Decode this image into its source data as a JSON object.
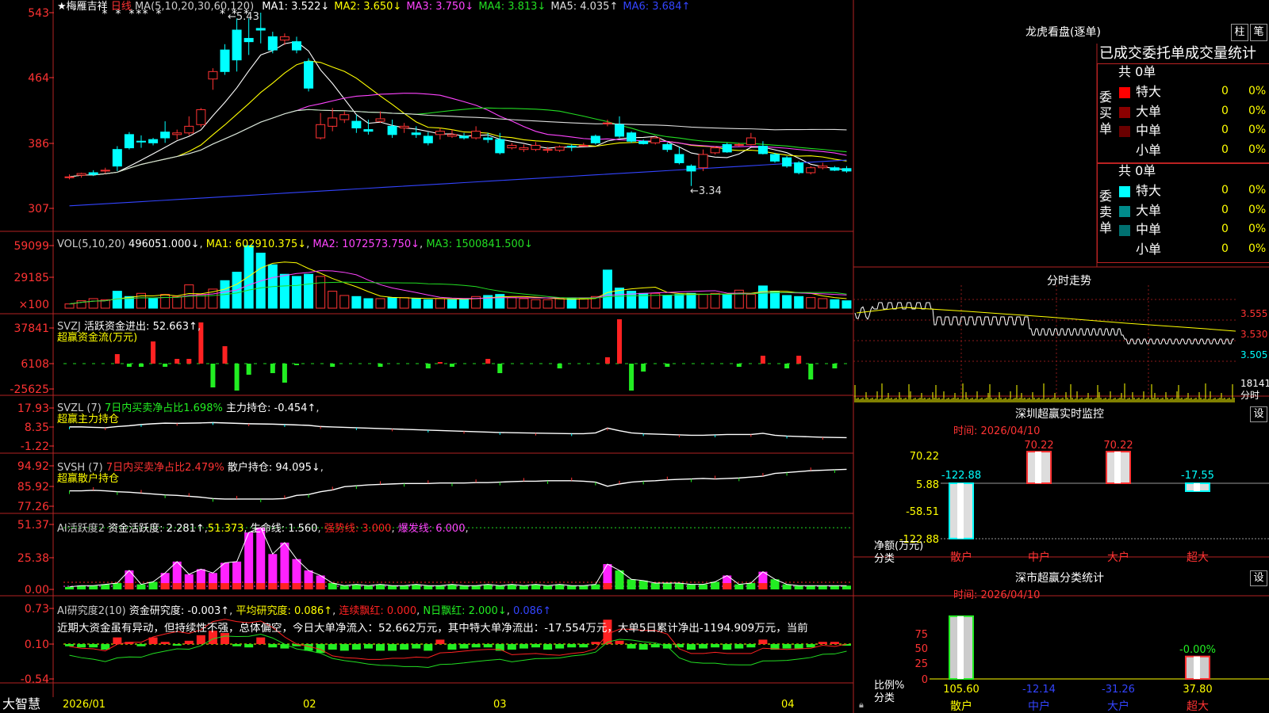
{
  "stock": {
    "name": "梅雁吉祥",
    "period": "日线",
    "ma_label": "MA(5,10,20,30,60,120)",
    "ma": [
      {
        "name": "MA1:",
        "value": "3.522↓",
        "color": "#ffffff"
      },
      {
        "name": "MA2:",
        "value": "3.650↓",
        "color": "#ffff00"
      },
      {
        "name": "MA3:",
        "value": "3.750↓",
        "color": "#ff44ff"
      },
      {
        "name": "MA4:",
        "value": "3.813↓",
        "color": "#22dd22"
      },
      {
        "name": "MA5:",
        "value": "4.035↑",
        "color": "#dddddd"
      },
      {
        "name": "MA6:",
        "value": "3.684↑",
        "color": "#3344ff"
      }
    ],
    "high_mark": "←5.43",
    "low_mark": "←3.34"
  },
  "axes": {
    "price": [
      "543",
      "464",
      "386",
      "307"
    ],
    "vol": [
      "59099",
      "29185",
      "×100"
    ],
    "svzj": [
      "37841",
      "6108",
      "-25625"
    ],
    "svzl": [
      "17.93",
      "8.35",
      "-1.22"
    ],
    "svsh": [
      "94.92",
      "85.92",
      "77.26"
    ],
    "ai2": [
      "51.37",
      "25.38",
      "0.00"
    ],
    "ai3": [
      "0.73",
      "0.10",
      "-0.54"
    ],
    "dates": [
      "2026/01",
      "02",
      "03",
      "04"
    ]
  },
  "panels": {
    "vol": {
      "label": "VOL(5,10,20)",
      "value": "496051.000↓",
      "ma1": "MA1: 602910.375↓",
      "ma2": "MA2: 1072573.750↓",
      "ma3": "MA3: 1500841.500↓"
    },
    "svzj": {
      "label": "SVZJ",
      "title": "活跃资金进出:",
      "value": "52.663↑",
      "comma": ",",
      "sub": "超赢资金流(万元)"
    },
    "svzl": {
      "label": "SVZL (7)",
      "title": "7日内买卖净占比1.698%",
      "extra": "主力持仓:",
      "value": "-0.454↑",
      "comma": ",",
      "sub": "超赢主力持仓"
    },
    "svsh": {
      "label": "SVSH (7)",
      "title": "7日内买卖净占比2.479%",
      "extra": "散户持仓:",
      "value": "94.095↓",
      "comma": ",",
      "sub": "超赢散户持仓"
    },
    "ai2": {
      "label": "AI活跃度2",
      "t1": "资金活跃度:",
      "v1": "2.281↑",
      "v2": "51.373",
      "t3": "生命线:",
      "v3": "1.560",
      "t4": "强势线:",
      "v4": "3.000",
      "t5": "爆发线:",
      "v5": "6.000"
    },
    "ai3": {
      "label": "AI研究度2(10)",
      "t1": "资金研究度:",
      "v1": "-0.003↑",
      "t2": "平均研究度:",
      "v2": "0.086↑",
      "t3": "连续飘红:",
      "v3": "0.000",
      "t4": "N日飘红:",
      "v4": "2.000↓",
      "v5": "0.086↑",
      "comment": "近期大资金虽有异动，但持续性不强，总体偏空，今日大单净流入：52.662万元，其中特大单净流出：-17.554万元，大单5日累计净出-1194.909万元，当前"
    }
  },
  "footer": {
    "logo": "大智慧"
  },
  "right": {
    "title": "龙虎看盘(逐单)",
    "btn1": "柱",
    "btn2": "笔",
    "header": "已成交委托单成交量统计",
    "buy": {
      "side": "委买单",
      "total": "共 0单",
      "rows": [
        {
          "label": "特大",
          "count": "0",
          "pct": "0%",
          "color": "#ff0000"
        },
        {
          "label": "大单",
          "count": "0",
          "pct": "0%",
          "color": "#8b0000"
        },
        {
          "label": "中单",
          "count": "0",
          "pct": "0%",
          "color": "#6a0000"
        },
        {
          "label": "小单",
          "count": "0",
          "pct": "0%",
          "color": ""
        }
      ]
    },
    "sell": {
      "side": "委卖单",
      "total": "共 0单",
      "rows": [
        {
          "label": "特大",
          "count": "0",
          "pct": "0%",
          "color": "#00ffff"
        },
        {
          "label": "大单",
          "count": "0",
          "pct": "0%",
          "color": "#008b8b"
        },
        {
          "label": "中单",
          "count": "0",
          "pct": "0%",
          "color": "#007070"
        },
        {
          "label": "小单",
          "count": "0",
          "pct": "0%",
          "color": ""
        }
      ]
    },
    "intraday": {
      "title": "分时走势",
      "p1": "3.555",
      "p2": "3.530",
      "p3": "3.505",
      "vol": "18141",
      "vlabel": "分时"
    },
    "monitor": {
      "title": "深圳超赢实时监控",
      "set": "设",
      "time": "时间: 2026/04/10",
      "yunit": "净额(万元)",
      "xunit": "分类"
    },
    "classify": {
      "title": "深市超赢分类统计",
      "set": "设",
      "time": "时间: 2026/04/10",
      "yunit": "比例%",
      "xunit": "分类"
    }
  },
  "chart_data": [
    {
      "type": "candlestick",
      "title": "梅雁吉祥 日线",
      "ylim": [
        3.07,
        5.43
      ],
      "x_ticks": [
        "2026/01",
        "02",
        "03",
        "04"
      ],
      "ohlc": [
        [
          3.44,
          3.48,
          3.42,
          3.45
        ],
        [
          3.47,
          3.5,
          3.44,
          3.49
        ],
        [
          3.5,
          3.53,
          3.46,
          3.48
        ],
        [
          3.52,
          3.56,
          3.49,
          3.53
        ],
        [
          3.78,
          3.82,
          3.52,
          3.58
        ],
        [
          3.96,
          3.99,
          3.78,
          3.8
        ],
        [
          3.88,
          3.95,
          3.8,
          3.87
        ],
        [
          3.9,
          3.92,
          3.83,
          3.86
        ],
        [
          3.99,
          4.12,
          3.86,
          3.92
        ],
        [
          3.96,
          4.02,
          3.9,
          3.98
        ],
        [
          3.98,
          4.18,
          3.95,
          4.06
        ],
        [
          4.08,
          4.28,
          4.05,
          4.26
        ],
        [
          4.63,
          4.76,
          4.5,
          4.72
        ],
        [
          4.98,
          5.05,
          4.68,
          4.72
        ],
        [
          5.22,
          5.36,
          4.72,
          4.86
        ],
        [
          5.12,
          5.36,
          4.92,
          5.08
        ],
        [
          5.24,
          5.43,
          5.06,
          5.22
        ],
        [
          5.14,
          5.2,
          4.94,
          4.98
        ],
        [
          5.1,
          5.18,
          5.04,
          5.14
        ],
        [
          5.08,
          5.14,
          4.94,
          4.98
        ],
        [
          4.84,
          4.88,
          4.48,
          4.52
        ],
        [
          3.92,
          4.22,
          3.9,
          4.08
        ],
        [
          4.06,
          4.28,
          4.0,
          4.16
        ],
        [
          4.14,
          4.24,
          4.1,
          4.2
        ],
        [
          4.12,
          4.2,
          3.98,
          4.04
        ],
        [
          4.02,
          4.14,
          3.96,
          4.0
        ],
        [
          4.12,
          4.24,
          4.1,
          4.15
        ],
        [
          4.06,
          4.14,
          3.92,
          3.96
        ],
        [
          4.04,
          4.1,
          3.98,
          4.06
        ],
        [
          3.98,
          4.06,
          3.92,
          3.96
        ],
        [
          3.94,
          3.99,
          3.83,
          3.86
        ],
        [
          3.96,
          4.04,
          3.9,
          4.0
        ],
        [
          3.94,
          4.02,
          3.92,
          3.96
        ],
        [
          3.94,
          3.98,
          3.9,
          3.92
        ],
        [
          3.92,
          4.06,
          3.9,
          4.0
        ],
        [
          3.92,
          3.98,
          3.86,
          3.9
        ],
        [
          3.9,
          3.98,
          3.72,
          3.74
        ],
        [
          3.8,
          3.86,
          3.78,
          3.83
        ],
        [
          3.78,
          3.84,
          3.75,
          3.8
        ],
        [
          3.78,
          3.87,
          3.76,
          3.83
        ],
        [
          3.78,
          3.81,
          3.74,
          3.78
        ],
        [
          3.77,
          3.83,
          3.75,
          3.81
        ],
        [
          3.82,
          3.84,
          3.76,
          3.81
        ],
        [
          3.82,
          3.86,
          3.82,
          3.83
        ],
        [
          3.94,
          3.96,
          3.84,
          3.86
        ],
        [
          4.1,
          4.14,
          4.06,
          4.1
        ],
        [
          4.08,
          4.18,
          3.92,
          3.94
        ],
        [
          3.98,
          4.0,
          3.86,
          3.88
        ],
        [
          3.88,
          3.9,
          3.84,
          3.85
        ],
        [
          3.86,
          3.94,
          3.84,
          3.92
        ],
        [
          3.84,
          3.86,
          3.75,
          3.78
        ],
        [
          3.72,
          3.81,
          3.6,
          3.62
        ],
        [
          3.58,
          3.6,
          3.34,
          3.52
        ],
        [
          3.56,
          3.78,
          3.52,
          3.72
        ],
        [
          3.74,
          3.82,
          3.72,
          3.8
        ],
        [
          3.84,
          3.86,
          3.74,
          3.75
        ],
        [
          3.84,
          3.86,
          3.82,
          3.84
        ],
        [
          3.84,
          3.98,
          3.83,
          3.92
        ],
        [
          3.82,
          3.88,
          3.72,
          3.73
        ],
        [
          3.72,
          3.74,
          3.62,
          3.64
        ],
        [
          3.68,
          3.7,
          3.56,
          3.58
        ],
        [
          3.62,
          3.64,
          3.48,
          3.5
        ],
        [
          3.5,
          3.58,
          3.48,
          3.56
        ],
        [
          3.56,
          3.62,
          3.54,
          3.58
        ],
        [
          3.56,
          3.58,
          3.52,
          3.53
        ],
        [
          3.55,
          3.58,
          3.5,
          3.52
        ]
      ],
      "series": [
        {
          "name": "MA1"
        },
        {
          "name": "MA2"
        },
        {
          "name": "MA3"
        },
        {
          "name": "MA4"
        },
        {
          "name": "MA5"
        },
        {
          "name": "MA6"
        }
      ]
    },
    {
      "type": "bar",
      "title": "VOL(5,10,20)",
      "ylim": [
        0,
        59099
      ],
      "values": [
        4,
        7,
        9,
        8,
        16,
        11,
        14,
        9,
        13,
        11,
        22,
        13,
        18,
        26,
        34,
        59,
        52,
        41,
        32,
        30,
        32,
        30,
        16,
        12,
        11,
        9,
        9,
        10,
        10,
        9,
        8,
        9,
        8,
        9,
        11,
        12,
        13,
        10,
        9,
        8,
        8,
        9,
        9,
        9,
        11,
        36,
        19,
        16,
        14,
        14,
        12,
        13,
        14,
        13,
        14,
        13,
        17,
        13,
        21,
        16,
        12,
        11,
        10,
        9,
        8,
        7
      ],
      "up": [
        1,
        1,
        1,
        1,
        0,
        0,
        1,
        0,
        1,
        1,
        1,
        1,
        1,
        0,
        0,
        0,
        0,
        0,
        0,
        0,
        0,
        1,
        1,
        1,
        0,
        0,
        1,
        0,
        1,
        0,
        0,
        1,
        0,
        0,
        1,
        0,
        0,
        1,
        1,
        1,
        1,
        1,
        0,
        1,
        1,
        0,
        0,
        0,
        0,
        1,
        0,
        0,
        0,
        1,
        1,
        0,
        1,
        1,
        0,
        0,
        0,
        0,
        1,
        1,
        0,
        0
      ]
    },
    {
      "type": "bar",
      "title": "SVZJ 活跃资金进出",
      "ylim": [
        -25625,
        37841
      ],
      "values": [
        0,
        0,
        0,
        0,
        6,
        -2,
        -2,
        14,
        -2,
        3,
        3,
        26,
        -15,
        11,
        -17,
        -7,
        0,
        -6,
        -12,
        -1,
        0,
        0,
        -2,
        0,
        0,
        0,
        -2,
        0,
        0,
        0,
        -3,
        1,
        -2,
        0,
        0,
        3,
        -6,
        0,
        0,
        0,
        0,
        -3,
        0,
        0,
        0,
        4,
        28,
        -17,
        -5,
        0,
        -2,
        0,
        0,
        0,
        0,
        0,
        -2,
        0,
        5,
        0,
        -3,
        5,
        -10,
        0,
        -3,
        0
      ]
    },
    {
      "type": "line",
      "title": "SVZL 主力持仓",
      "ylim": [
        -1.22,
        17.93
      ],
      "values": [
        8.4,
        8.4,
        8.2,
        8.0,
        8.6,
        9.0,
        9.6,
        10.0,
        10.3,
        10.2,
        10.3,
        10.4,
        10.6,
        10.4,
        10.2,
        10.0,
        9.9,
        9.8,
        9.6,
        9.4,
        9.2,
        8.6,
        8.4,
        8.2,
        8.0,
        7.8,
        7.6,
        7.4,
        7.2,
        7.0,
        6.8,
        6.6,
        6.4,
        6.2,
        6.0,
        5.8,
        5.6,
        5.5,
        5.4,
        5.3,
        5.2,
        5.1,
        5.0,
        5.0,
        5.4,
        7.8,
        6.5,
        5.4,
        5.0,
        4.8,
        4.6,
        4.4,
        4.2,
        4.2,
        4.4,
        4.6,
        4.6,
        4.6,
        5.2,
        4.2,
        3.8,
        3.6,
        3.4,
        3.2,
        3.1,
        3.0
      ]
    },
    {
      "type": "line",
      "title": "SVSH 散户持仓",
      "ylim": [
        77.26,
        94.92
      ],
      "values": [
        84.0,
        84.0,
        84.2,
        84.0,
        83.6,
        83.4,
        83.0,
        82.6,
        82.2,
        82.0,
        81.6,
        81.2,
        80.6,
        80.4,
        80.4,
        80.4,
        80.4,
        80.4,
        80.6,
        82.0,
        82.4,
        83.6,
        84.4,
        85.8,
        86.2,
        86.6,
        86.8,
        87.0,
        87.2,
        87.2,
        87.2,
        87.4,
        87.4,
        87.4,
        87.6,
        87.6,
        87.8,
        88.0,
        88.2,
        88.2,
        88.4,
        88.4,
        88.4,
        88.2,
        87.8,
        86.0,
        87.0,
        87.8,
        88.2,
        88.4,
        88.8,
        89.0,
        89.2,
        89.4,
        89.2,
        89.4,
        89.6,
        90.0,
        90.4,
        91.6,
        92.0,
        92.4,
        92.8,
        93.0,
        93.2,
        93.4
      ]
    },
    {
      "type": "bar",
      "title": "AI活跃度2 资金活跃度",
      "ylim": [
        0,
        51.37
      ],
      "values": [
        2,
        3,
        3,
        4,
        5,
        15,
        4,
        6,
        13,
        22,
        12,
        16,
        13,
        21,
        22,
        45,
        49,
        28,
        37,
        24,
        15,
        11,
        5,
        3,
        4,
        3,
        4,
        3,
        3,
        4,
        3,
        3,
        4,
        3,
        3,
        4,
        3,
        4,
        3,
        4,
        3,
        4,
        3,
        3,
        4,
        20,
        15,
        8,
        7,
        5,
        5,
        5,
        4,
        4,
        6,
        11,
        4,
        5,
        14,
        8,
        4,
        3,
        3,
        3,
        3,
        3
      ],
      "magenta": [
        0,
        0,
        0,
        0,
        0,
        1,
        0,
        0,
        1,
        1,
        1,
        1,
        1,
        1,
        1,
        1,
        1,
        1,
        1,
        1,
        1,
        1,
        0,
        0,
        0,
        0,
        0,
        0,
        0,
        0,
        0,
        0,
        0,
        0,
        0,
        0,
        0,
        0,
        0,
        0,
        0,
        0,
        0,
        0,
        0,
        1,
        0,
        0,
        0,
        0,
        0,
        0,
        0,
        0,
        0,
        1,
        0,
        0,
        1,
        0,
        0,
        0,
        0,
        0,
        0,
        0
      ]
    },
    {
      "type": "bar",
      "title": "AI研究度2(10) 资金研究度",
      "ylim": [
        -0.54,
        0.73
      ],
      "values": [
        -0.02,
        -0.03,
        -0.03,
        -0.05,
        0.06,
        0.02,
        -0.02,
        0.06,
        0.02,
        -0.01,
        0.03,
        0.08,
        0.12,
        0.1,
        -0.02,
        -0.03,
        0.06,
        -0.03,
        -0.04,
        -0.02,
        -0.06,
        -0.08,
        -0.05,
        -0.06,
        -0.05,
        -0.04,
        -0.06,
        -0.06,
        -0.05,
        -0.04,
        -0.06,
        0.04,
        -0.05,
        -0.04,
        -0.03,
        -0.03,
        -0.06,
        -0.05,
        -0.04,
        -0.03,
        -0.05,
        -0.04,
        -0.03,
        -0.03,
        0.02,
        0.22,
        0.03,
        -0.04,
        -0.05,
        -0.03,
        -0.04,
        -0.03,
        -0.05,
        -0.04,
        -0.03,
        -0.05,
        -0.04,
        -0.03,
        0.04,
        -0.05,
        -0.04,
        -0.04,
        -0.03,
        0.02,
        0.02,
        -0.01
      ]
    },
    {
      "type": "bar",
      "title": "深圳超赢实时监控",
      "ylim": [
        -122.88,
        70.22
      ],
      "categories": [
        "散户",
        "中户",
        "大户",
        "超大"
      ],
      "values": [
        -122.88,
        70.22,
        70.22,
        -17.55
      ],
      "labels": [
        "-122.88",
        "70.22",
        "70.22",
        "-17.55"
      ],
      "ticks": [
        "70.22",
        "5.88",
        "-58.51",
        "-122.88"
      ]
    },
    {
      "type": "bar",
      "title": "深市超赢分类统计",
      "ylim": [
        0,
        100
      ],
      "categories": [
        "散户",
        "中户",
        "大户",
        "超大"
      ],
      "values": [
        105.6,
        -12.14,
        -31.26,
        37.8
      ],
      "labels": [
        "105.60",
        "-12.14",
        "-31.26",
        "37.80"
      ],
      "top_label": "-0.00%",
      "ticks": [
        "75",
        "50",
        "25",
        "0"
      ]
    }
  ]
}
